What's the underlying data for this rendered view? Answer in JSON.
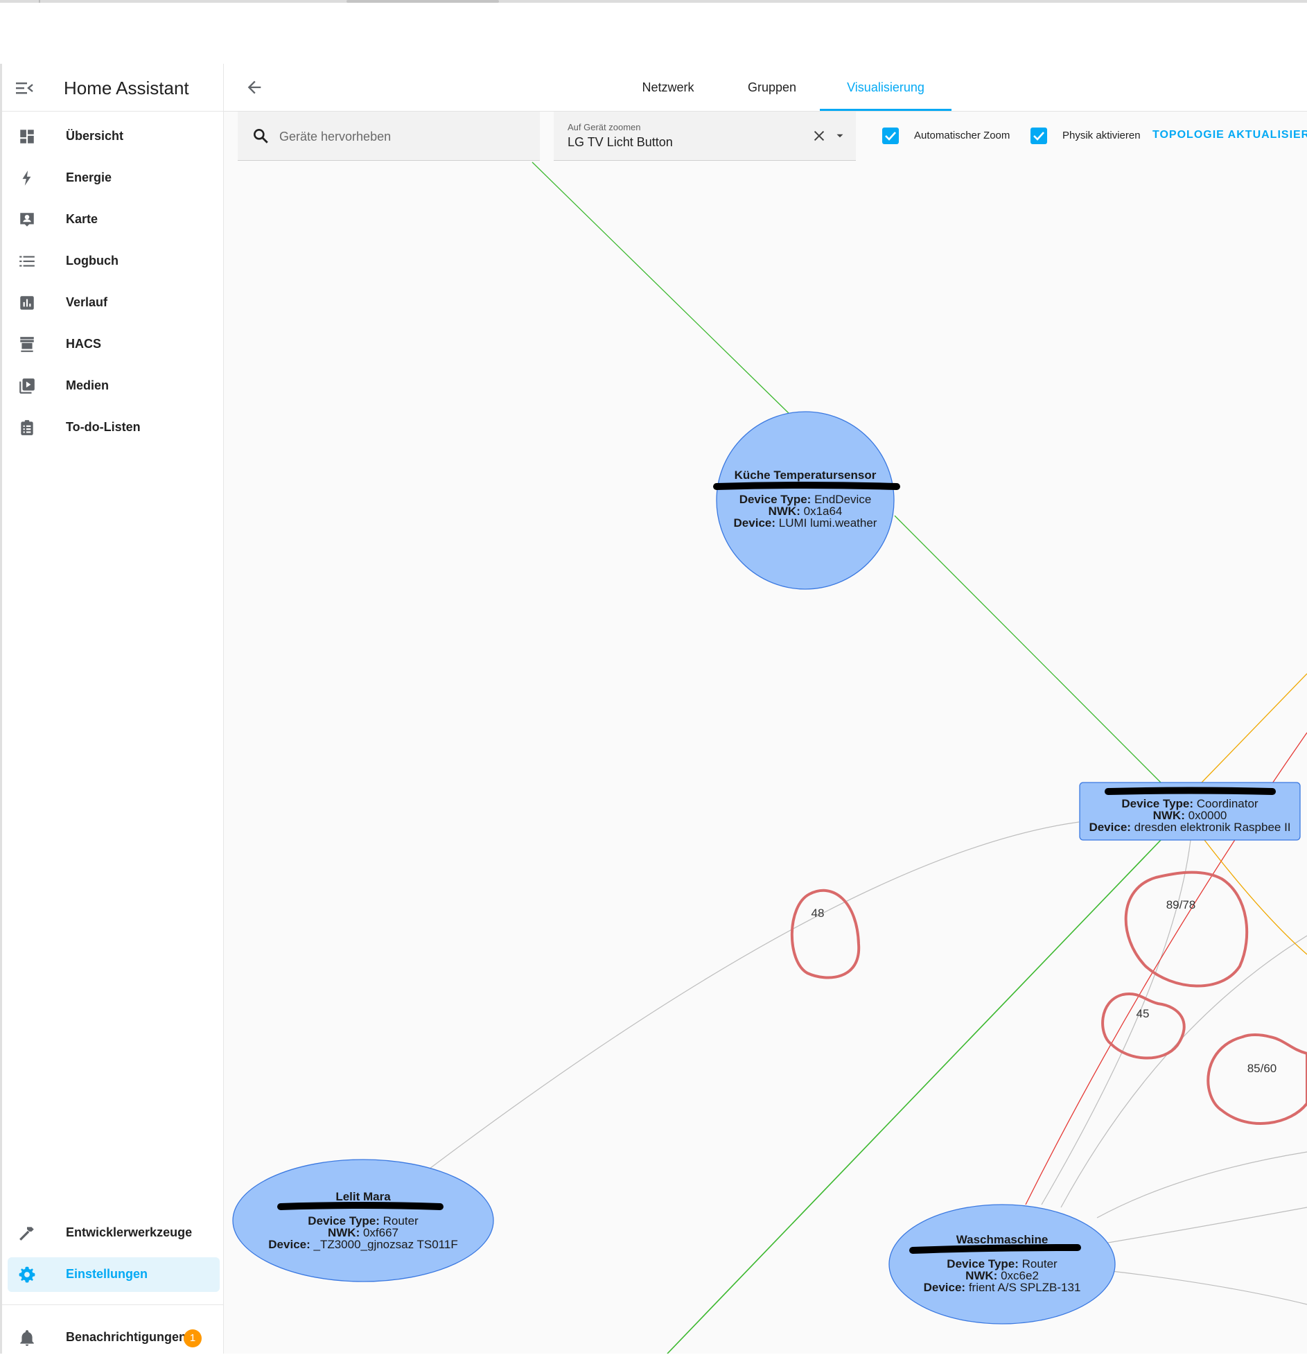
{
  "sidebar": {
    "title": "Home Assistant",
    "items": [
      {
        "label": "Übersicht",
        "icon": "dashboard-icon"
      },
      {
        "label": "Energie",
        "icon": "lightning-bolt-icon"
      },
      {
        "label": "Karte",
        "icon": "map-account-icon"
      },
      {
        "label": "Logbuch",
        "icon": "list-icon"
      },
      {
        "label": "Verlauf",
        "icon": "chart-box-icon"
      },
      {
        "label": "HACS",
        "icon": "hacs-store-icon"
      },
      {
        "label": "Medien",
        "icon": "play-box-multiple-icon"
      },
      {
        "label": "To-do-Listen",
        "icon": "clipboard-list-icon"
      }
    ],
    "bottom_items": [
      {
        "label": "Entwicklerwerkzeuge",
        "icon": "hammer-icon"
      },
      {
        "label": "Einstellungen",
        "icon": "cog-icon",
        "active": true
      }
    ],
    "notifications": {
      "label": "Benachrichtigungen",
      "count": "1",
      "icon": "bell-icon"
    }
  },
  "header": {
    "tabs": [
      {
        "label": "Netzwerk"
      },
      {
        "label": "Gruppen"
      },
      {
        "label": "Visualisierung",
        "active": true
      }
    ]
  },
  "toolbar": {
    "search_placeholder": "Geräte hervorheben",
    "zoom_label": "Auf Gerät zoomen",
    "zoom_value": "LG TV Licht Button",
    "auto_zoom_label": "Automatischer Zoom",
    "auto_zoom_checked": true,
    "physics_label": "Physik aktivieren",
    "physics_checked": true,
    "refresh_label": "TOPOLOGIE AKTUALISIEREN"
  },
  "graph": {
    "colors": {
      "node_fill": "#9cc3fa",
      "node_stroke": "#3a78e0",
      "edge_green": "#3cb82f",
      "edge_gray": "#bdbdbd",
      "edge_red": "#e53935",
      "edge_orange": "#f0a800",
      "annotation": "#d96a6a",
      "redaction": "#000000"
    },
    "nodes": [
      {
        "id": "kueche",
        "title": "Küche Temperatursensor",
        "device_type": "EndDevice",
        "nwk": "0x1a64",
        "device": "LUMI lumi.weather"
      },
      {
        "id": "coordinator",
        "title": "",
        "device_type": "Coordinator",
        "nwk": "0x0000",
        "device": "dresden elektronik Raspbee II"
      },
      {
        "id": "lelit",
        "title": "Lelit Mara",
        "device_type": "Router",
        "nwk": "0xf667",
        "device": "_TZ3000_gjnozsaz TS011F"
      },
      {
        "id": "waschmaschine",
        "title": "Waschmaschine",
        "device_type": "Router",
        "nwk": "0xc6e2",
        "device": "frient A/S SPLZB-131"
      }
    ],
    "keys": {
      "device_type": "Device Type:",
      "nwk": "NWK:",
      "device": "Device:"
    },
    "edge_labels": [
      "48",
      "89/78",
      "45",
      "85/60"
    ]
  }
}
